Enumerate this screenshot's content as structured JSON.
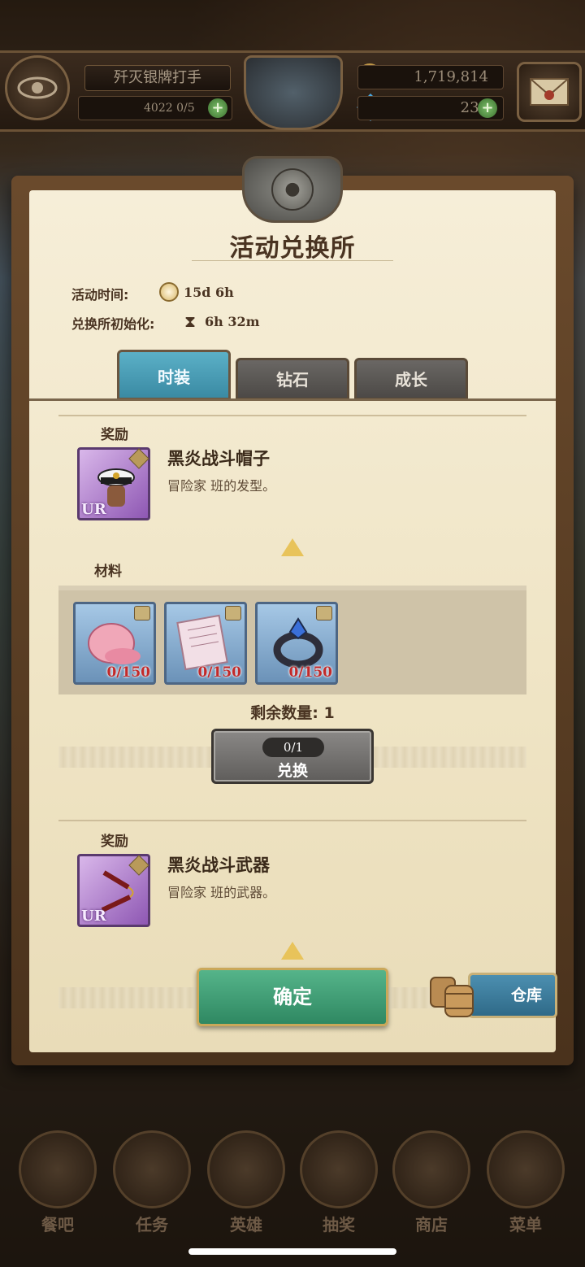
{
  "topbar": {
    "player_title": "歼灭银牌打手",
    "stamina": "4022 0/5",
    "gold": "1,719,814",
    "gems": "235"
  },
  "panel": {
    "title": "活动兑换所",
    "event_time_label": "活动时间:",
    "event_time_value": "15d 6h",
    "reset_label": "兑换所初始化:",
    "reset_value": "6h 32m"
  },
  "tabs": [
    {
      "label": "时装",
      "active": true
    },
    {
      "label": "钻石",
      "active": false
    },
    {
      "label": "成长",
      "active": false
    }
  ],
  "rewards": [
    {
      "section_label": "奖励",
      "name": "黑炎战斗帽子",
      "desc": "冒险家 班的发型。",
      "rarity": "UR",
      "icon": "hat-icon"
    },
    {
      "section_label": "奖励",
      "name": "黑炎战斗武器",
      "desc": "冒险家 班的武器。",
      "rarity": "UR",
      "icon": "nunchaku-icon"
    }
  ],
  "materials": {
    "label": "材料",
    "items": [
      {
        "icon": "pink-shell-icon",
        "count": "0/150"
      },
      {
        "icon": "letter-icon",
        "count": "0/150"
      },
      {
        "icon": "ring-icon",
        "count": "0/150"
      }
    ]
  },
  "exchange": {
    "remaining_label": "剩余数量:  1",
    "progress": "0/1",
    "button_label": "兑换"
  },
  "footer": {
    "confirm_label": "确定",
    "warehouse_label": "仓库"
  },
  "bottom_nav": [
    {
      "label": "餐吧"
    },
    {
      "label": "任务"
    },
    {
      "label": "英雄"
    },
    {
      "label": "抽奖"
    },
    {
      "label": "商店"
    },
    {
      "label": "菜单"
    }
  ],
  "colors": {
    "tab_active": "#3a8aa3",
    "confirm": "#2f8862",
    "warehouse": "#2f6a88",
    "material_count": "#c22a2a",
    "ur_frame": "#8e57b3"
  }
}
